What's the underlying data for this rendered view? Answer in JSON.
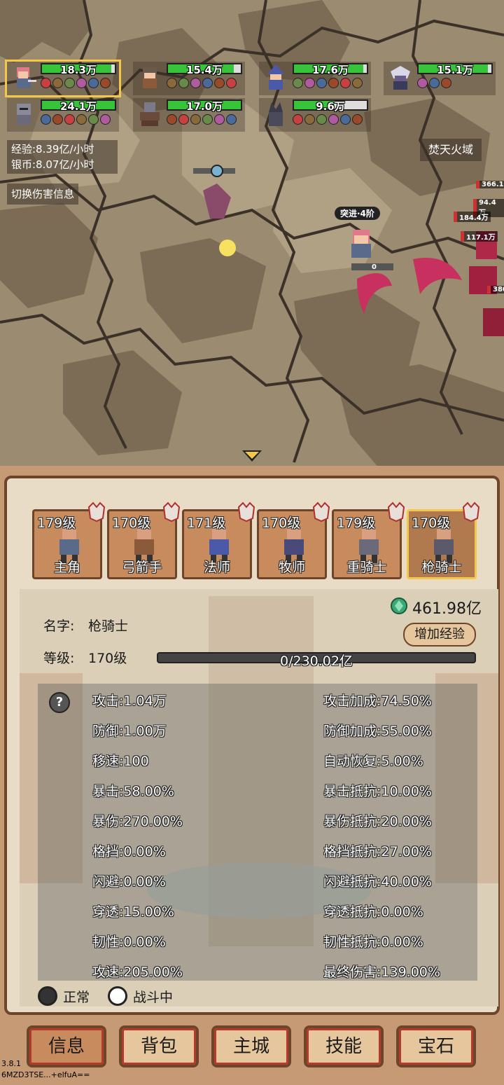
{
  "colors": {
    "hp_green": "#37c43a",
    "panel_border": "#6e4528",
    "selected_gold": "#f3c84a",
    "button_bg": "#e6c69c",
    "nav_accent": "#b43b2b"
  },
  "party": [
    {
      "hp_text": "18.3万",
      "hp_fraction": 0.95,
      "selected": true
    },
    {
      "hp_text": "15.4万",
      "hp_fraction": 0.9,
      "selected": false
    },
    {
      "hp_text": "17.6万",
      "hp_fraction": 0.95,
      "selected": false
    },
    {
      "hp_text": "15.1万",
      "hp_fraction": 0.95,
      "selected": false
    },
    {
      "hp_text": "24.1万",
      "hp_fraction": 1.0,
      "selected": false
    },
    {
      "hp_text": "17.0万",
      "hp_fraction": 1.0,
      "selected": false
    },
    {
      "hp_text": "9.6万",
      "hp_fraction": 0.55,
      "selected": false
    }
  ],
  "rates": {
    "exp_line": "经验:8.39亿/小时",
    "silver_line": "银币:8.07亿/小时"
  },
  "toggle_damage_label": "切换伤害信息",
  "zone_name": "焚天火域",
  "battle": {
    "rush_label": "突进·4阶",
    "zero_label": "0",
    "damage_numbers": [
      "366.1",
      "94.4万",
      "184.4万",
      "117.1万",
      "380"
    ]
  },
  "characters": [
    {
      "level": "179级",
      "name": "主角",
      "active": false
    },
    {
      "level": "170级",
      "name": "弓箭手",
      "active": false
    },
    {
      "level": "171级",
      "name": "法师",
      "active": false
    },
    {
      "level": "170级",
      "name": "牧师",
      "active": false
    },
    {
      "level": "179级",
      "name": "重骑士",
      "active": false
    },
    {
      "level": "170级",
      "name": "枪骑士",
      "active": true
    }
  ],
  "info": {
    "gem_amount": "461.98亿",
    "name_label": "名字:",
    "name_value": "枪骑士",
    "level_label": "等级:",
    "level_value": "170级",
    "add_exp_label": "增加经验",
    "exp_text": "0/230.02亿",
    "exp_fraction": 0.0
  },
  "help_label": "?",
  "stats_left": [
    "攻击:1.04万",
    "防御:1.00万",
    "移速:100",
    "暴击:58.00%",
    "暴伤:270.00%",
    "格挡:0.00%",
    "闪避:0.00%",
    "穿透:15.00%",
    "韧性:0.00%",
    "攻速:205.00%"
  ],
  "stats_right": [
    "攻击加成:74.50%",
    "防御加成:55.00%",
    "自动恢复:5.00%",
    "暴击抵抗:10.00%",
    "暴伤抵抗:20.00%",
    "格挡抵抗:27.00%",
    "闪避抵抗:40.00%",
    "穿透抵抗:0.00%",
    "韧性抵抗:0.00%",
    "最终伤害:139.00%"
  ],
  "legend": {
    "normal_label": "正常",
    "fighting_label": "战斗中"
  },
  "nav": [
    {
      "label": "信息",
      "active": true
    },
    {
      "label": "背包",
      "active": false
    },
    {
      "label": "主城",
      "active": false
    },
    {
      "label": "技能",
      "active": false
    },
    {
      "label": "宝石",
      "active": false
    }
  ],
  "version": {
    "number": "3.8.1",
    "code": "6MZD3TSE...+elfuA=="
  }
}
